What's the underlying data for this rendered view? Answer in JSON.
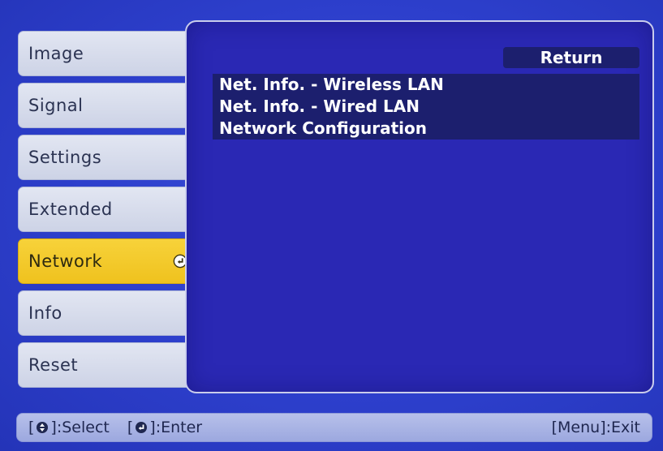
{
  "sidebar": {
    "items": [
      {
        "label": "Image"
      },
      {
        "label": "Signal"
      },
      {
        "label": "Settings"
      },
      {
        "label": "Extended"
      },
      {
        "label": "Network",
        "active": true
      },
      {
        "label": "Info"
      },
      {
        "label": "Reset"
      }
    ]
  },
  "panel": {
    "return_label": "Return",
    "items": [
      {
        "label": "Net. Info. - Wireless LAN"
      },
      {
        "label": "Net. Info. - Wired LAN"
      },
      {
        "label": "Network Configuration"
      }
    ]
  },
  "statusbar": {
    "select_label": ":Select",
    "enter_label": ":Enter",
    "exit_label": "[Menu]:Exit",
    "bracket_open": "[",
    "bracket_close": "]"
  },
  "colors": {
    "background": "#2f40cf",
    "panel": "#2a28b4",
    "selected_item": "#1c1f6e",
    "active_tab": "#f2c82a",
    "tab": "#d7dcee"
  },
  "icons": {
    "active_tab_icon": "enter-icon",
    "select_icon": "up-down-arrow-icon",
    "enter_icon": "enter-icon"
  }
}
